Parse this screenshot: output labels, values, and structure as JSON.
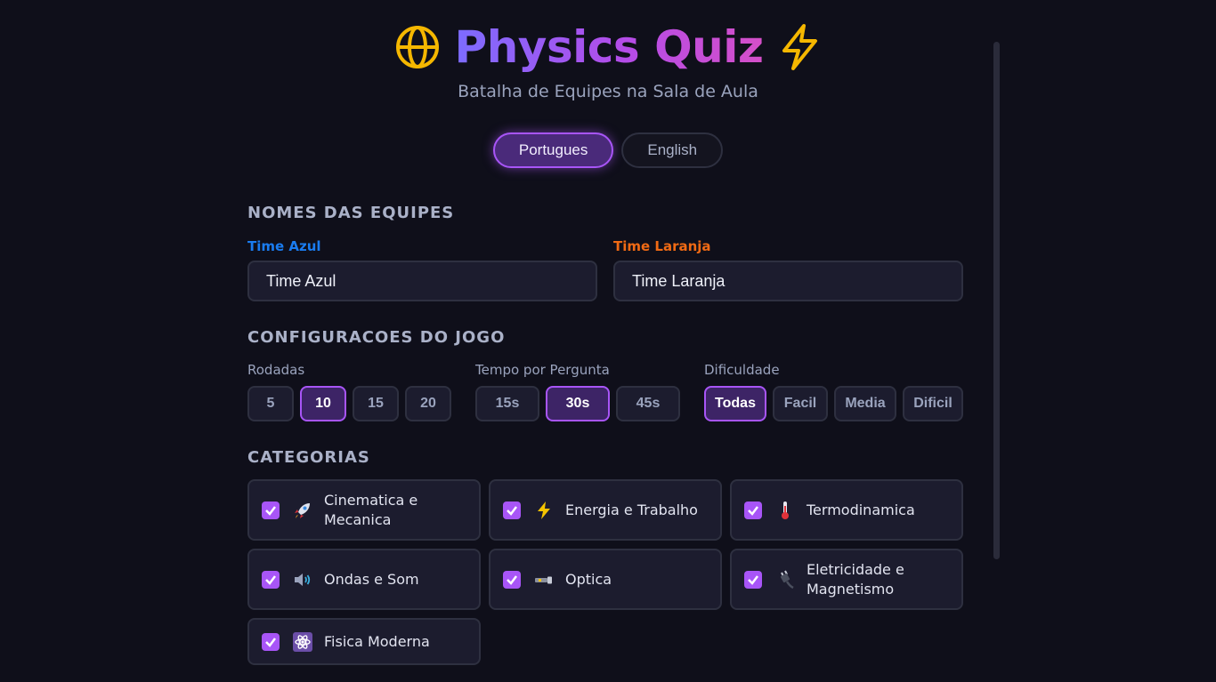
{
  "header": {
    "title": "Physics Quiz",
    "subtitle": "Batalha de Equipes na Sala de Aula",
    "left_icon": "globe-icon",
    "right_icon": "lightning-icon"
  },
  "language": {
    "options": [
      "Portugues",
      "English"
    ],
    "selected": "Portugues"
  },
  "teams": {
    "section_title": "NOMES DAS EQUIPES",
    "blue": {
      "label": "Time Azul",
      "value": "Time Azul",
      "color": "#1a7cf0"
    },
    "orange": {
      "label": "Time Laranja",
      "value": "Time Laranja",
      "color": "#f06a14"
    }
  },
  "settings": {
    "section_title": "CONFIGURACOES DO JOGO",
    "rounds": {
      "label": "Rodadas",
      "options": [
        "5",
        "10",
        "15",
        "20"
      ],
      "selected": "10"
    },
    "time": {
      "label": "Tempo por Pergunta",
      "options": [
        "15s",
        "30s",
        "45s"
      ],
      "selected": "30s"
    },
    "difficulty": {
      "label": "Dificuldade",
      "options": [
        "Todas",
        "Facil",
        "Media",
        "Dificil"
      ],
      "selected": "Todas"
    }
  },
  "categories": {
    "section_title": "CATEGORIAS",
    "items": [
      {
        "label": "Cinematica e Mecanica",
        "icon": "rocket-icon",
        "checked": true
      },
      {
        "label": "Energia e Trabalho",
        "icon": "lightning-icon",
        "checked": true
      },
      {
        "label": "Termodinamica",
        "icon": "thermometer-icon",
        "checked": true
      },
      {
        "label": "Ondas e Som",
        "icon": "speaker-icon",
        "checked": true
      },
      {
        "label": "Optica",
        "icon": "flashlight-icon",
        "checked": true
      },
      {
        "label": "Eletricidade e Magnetismo",
        "icon": "plug-icon",
        "checked": true
      },
      {
        "label": "Fisica Moderna",
        "icon": "atom-icon",
        "checked": true
      }
    ]
  },
  "colors": {
    "background": "#0f0f1a",
    "panel": "#1c1c2e",
    "accent": "#a855f7",
    "gold": "#f5b700"
  }
}
